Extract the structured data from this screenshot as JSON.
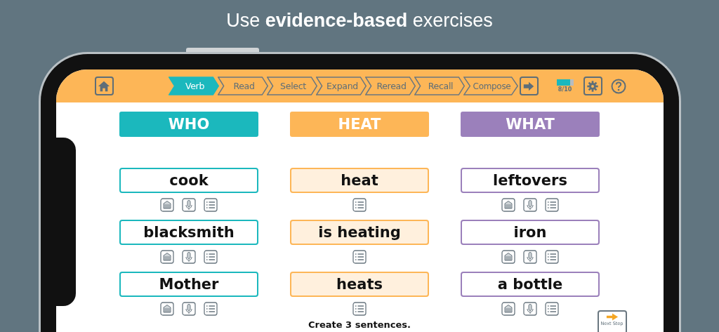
{
  "headline": "Use **evidence-based** exercises",
  "toolbar": {
    "steps": [
      {
        "label": "Verb",
        "selected": true
      },
      {
        "label": "Read",
        "selected": false
      },
      {
        "label": "Select",
        "selected": false
      },
      {
        "label": "Expand",
        "selected": false
      },
      {
        "label": "Reread",
        "selected": false
      },
      {
        "label": "Recall",
        "selected": false
      },
      {
        "label": "Compose",
        "selected": false
      }
    ],
    "progress": {
      "level": 0.8,
      "reading": "8/10"
    }
  },
  "columns": [
    {
      "header": "WHO",
      "color": "#1bb8bd",
      "filled": false,
      "cards": [
        {
          "text": "cook",
          "tools": [
            {
              "kind": "keyboard"
            },
            {
              "kind": "mic"
            },
            {
              "kind": "list"
            }
          ]
        },
        {
          "text": "blacksmith",
          "tools": [
            {
              "kind": "keyboard"
            },
            {
              "kind": "mic"
            },
            {
              "kind": "list"
            }
          ]
        },
        {
          "text": "Mother",
          "tools": [
            {
              "kind": "keyboard"
            },
            {
              "kind": "mic"
            },
            {
              "kind": "list"
            }
          ]
        }
      ]
    },
    {
      "header": "HEAT",
      "color": "#fdb657",
      "filled": true,
      "cards": [
        {
          "text": "heat",
          "tools": [
            {
              "kind": "list"
            }
          ]
        },
        {
          "text": "is heating",
          "tools": [
            {
              "kind": "list"
            }
          ]
        },
        {
          "text": "heats",
          "tools": [
            {
              "kind": "list"
            }
          ]
        }
      ]
    },
    {
      "header": "WHAT",
      "color": "#9b80bb",
      "filled": false,
      "cards": [
        {
          "text": "leftovers",
          "tools": [
            {
              "kind": "keyboard"
            },
            {
              "kind": "mic"
            },
            {
              "kind": "list"
            }
          ]
        },
        {
          "text": "iron",
          "tools": [
            {
              "kind": "keyboard"
            },
            {
              "kind": "mic"
            },
            {
              "kind": "list"
            }
          ]
        },
        {
          "text": "a bottle",
          "tools": [
            {
              "kind": "keyboard"
            },
            {
              "kind": "mic"
            },
            {
              "kind": "list"
            }
          ]
        }
      ]
    }
  ],
  "instruction": "Create 3 sentences.",
  "next_button": "Next Step"
}
